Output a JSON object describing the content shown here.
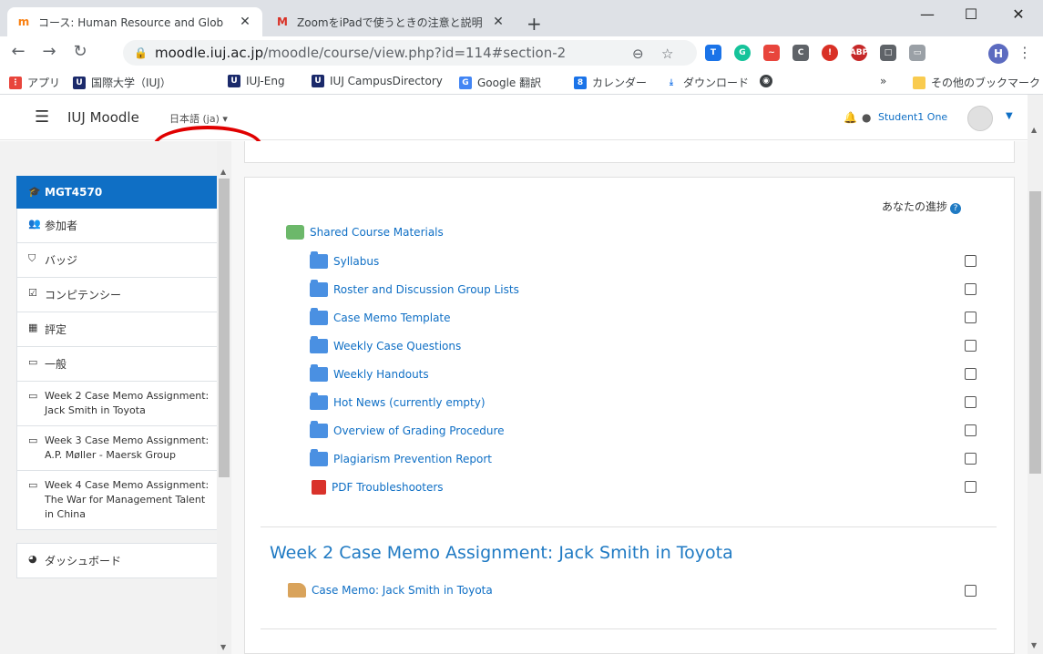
{
  "browser": {
    "tabs": [
      {
        "title": "コース: Human Resource and Glob",
        "favicon": "moodle-icon",
        "active": true
      },
      {
        "title": "ZoomをiPadで使うときの注意と説明",
        "favicon": "gmail-icon",
        "active": false
      }
    ],
    "new_tab": "+",
    "url_host": "moodle.iuj.ac.jp",
    "url_path": "/moodle/course/view.php?id=114#section-2",
    "profile_initial": "H",
    "bookmarks": [
      "アプリ",
      "国際大学（IUJ）",
      "IUJ-Eng",
      "IUJ CampusDirectory",
      "Google 翻訳",
      "カレンダー",
      "ダウンロード",
      "その他のブックマーク"
    ],
    "bookmarks_overflow": "»"
  },
  "navbar": {
    "site_name": "IUJ Moodle",
    "language": "日本語 (ja) ▾",
    "user_name": "Student1 One"
  },
  "drawer": {
    "course": "MGT4570",
    "items": [
      {
        "icon": "users-icon",
        "label": "参加者"
      },
      {
        "icon": "badge-icon",
        "label": "バッジ"
      },
      {
        "icon": "checkbox-icon",
        "label": "コンピテンシー"
      },
      {
        "icon": "grid-icon",
        "label": "評定"
      },
      {
        "icon": "folder-icon",
        "label": "一般"
      },
      {
        "icon": "folder-icon",
        "label": "Week 2 Case Memo Assignment: Jack Smith in Toyota"
      },
      {
        "icon": "folder-icon",
        "label": "Week 3 Case Memo Assignment: A.P. Møller - Maersk Group"
      },
      {
        "icon": "folder-icon",
        "label": "Week 4 Case Memo Assignment: The War for Management Talent in China"
      }
    ],
    "dashboard": "ダッシュボード"
  },
  "main": {
    "progress_label": "あなたの進捗",
    "activities": [
      {
        "type": "forum",
        "label": "Shared Course Materials"
      },
      {
        "type": "folder",
        "label": "Syllabus"
      },
      {
        "type": "folder",
        "label": "Roster and Discussion Group Lists"
      },
      {
        "type": "folder",
        "label": "Case Memo Template"
      },
      {
        "type": "folder",
        "label": "Weekly Case Questions"
      },
      {
        "type": "folder",
        "label": "Weekly Handouts"
      },
      {
        "type": "folder",
        "label": "Hot News (currently empty)"
      },
      {
        "type": "folder",
        "label": "Overview of Grading Procedure"
      },
      {
        "type": "folder",
        "label": "Plagiarism Prevention Report"
      },
      {
        "type": "pdf",
        "label": "PDF Troubleshooters"
      }
    ],
    "section2_title": "Week 2 Case Memo Assignment: Jack Smith in Toyota",
    "section2_activity": "Case Memo: Jack Smith in Toyota"
  },
  "colors": {
    "moodle_blue": "#0f6fc5",
    "annotation_red": "#e00000"
  }
}
